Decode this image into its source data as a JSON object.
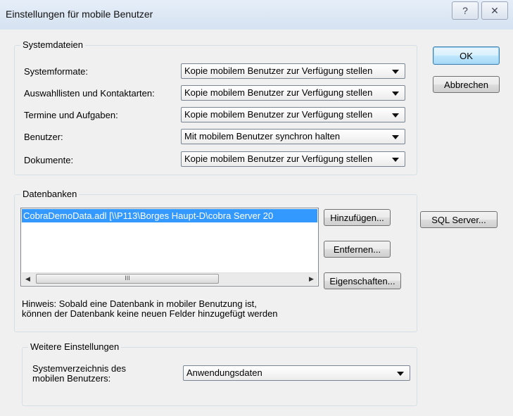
{
  "window": {
    "title": "Einstellungen für mobile Benutzer",
    "help_glyph": "?",
    "close_glyph": "✕"
  },
  "buttons": {
    "ok": "OK",
    "cancel": "Abbrechen",
    "add": "Hinzufügen...",
    "remove": "Entfernen...",
    "properties": "Eigenschaften...",
    "sql_server": "SQL Server..."
  },
  "systemdateien": {
    "group_label": "Systemdateien",
    "rows": [
      {
        "label": "Systemformate:",
        "value": "Kopie mobilem Benutzer zur Verfügung stellen"
      },
      {
        "label": "Auswahllisten und Kontaktarten:",
        "value": "Kopie mobilem Benutzer zur Verfügung stellen"
      },
      {
        "label": "Termine und Aufgaben:",
        "value": "Kopie mobilem Benutzer zur Verfügung stellen"
      },
      {
        "label": "Benutzer:",
        "value": "Mit mobilem Benutzer synchron halten"
      },
      {
        "label": "Dokumente:",
        "value": "Kopie mobilem Benutzer zur Verfügung stellen"
      }
    ]
  },
  "datenbanken": {
    "group_label": "Datenbanken",
    "items": [
      {
        "text": "CobraDemoData.adl    [\\\\P113\\Borges Haupt-D\\cobra Server 20",
        "selected": true
      }
    ],
    "scroll_thumb_glyph": "III",
    "hint": "Hinweis: Sobald eine Datenbank in mobiler Benutzung ist, können der Datenbank keine neuen Felder hinzugefügt werden"
  },
  "weitere": {
    "group_label": "Weitere Einstellungen",
    "label": "Systemverzeichnis des mobilen Benutzers:",
    "value": "Anwendungsdaten"
  }
}
